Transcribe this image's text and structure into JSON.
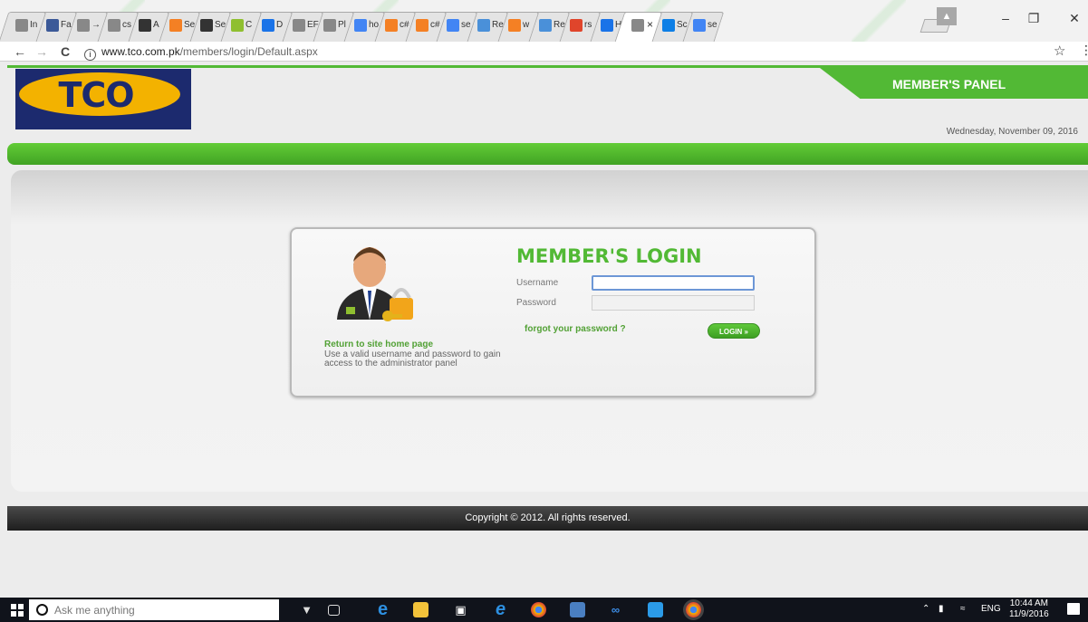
{
  "browser": {
    "tabs": [
      {
        "label": "In",
        "icon": "generic-icon",
        "color": "#888888"
      },
      {
        "label": "Fa",
        "icon": "facebook-icon",
        "color": "#3b5998"
      },
      {
        "label": "→",
        "icon": "page-icon",
        "color": "#888888"
      },
      {
        "label": "cs",
        "icon": "generic-icon",
        "color": "#888888"
      },
      {
        "label": "A",
        "icon": "codepen-icon",
        "color": "#333333"
      },
      {
        "label": "Se",
        "icon": "asterisk-icon",
        "color": "#f48024"
      },
      {
        "label": "Se",
        "icon": "codepen-icon",
        "color": "#333333"
      },
      {
        "label": "C",
        "icon": "app-icon",
        "color": "#8fbf30"
      },
      {
        "label": "D",
        "icon": "refresh-icon",
        "color": "#1a73e8"
      },
      {
        "label": "EF",
        "icon": "loading-icon",
        "color": "#888888"
      },
      {
        "label": "Pl",
        "icon": "loading-icon",
        "color": "#888888"
      },
      {
        "label": "ho",
        "icon": "google-icon",
        "color": "#4285f4"
      },
      {
        "label": "c#",
        "icon": "stackoverflow-icon",
        "color": "#f48024"
      },
      {
        "label": "c#",
        "icon": "stackoverflow-icon",
        "color": "#f48024"
      },
      {
        "label": "se",
        "icon": "google-icon",
        "color": "#4285f4"
      },
      {
        "label": "Re",
        "icon": "globe-icon",
        "color": "#4a90d9"
      },
      {
        "label": "w",
        "icon": "stackoverflow-icon",
        "color": "#f48024"
      },
      {
        "label": "Re",
        "icon": "globe-icon",
        "color": "#4a90d9"
      },
      {
        "label": "rs",
        "icon": "settings-icon",
        "color": "#e0452b"
      },
      {
        "label": "H",
        "icon": "refresh-icon",
        "color": "#1a73e8"
      },
      {
        "label": "×",
        "icon": "page-icon",
        "color": "#888888",
        "active": true
      },
      {
        "label": "Sc",
        "icon": "dropbox-icon",
        "color": "#0d7fe6"
      },
      {
        "label": "se",
        "icon": "google-icon",
        "color": "#4285f4"
      }
    ],
    "url_host": "www.tco.com.pk",
    "url_path": "/members/login/Default.aspx"
  },
  "header": {
    "logo_text": "TCO",
    "member_panel_label": "MEMBER'S PANEL",
    "date": "Wednesday, November 09, 2016"
  },
  "login": {
    "title": "MEMBER'S LOGIN",
    "username_label": "Username",
    "password_label": "Password",
    "username_value": "",
    "password_value": "",
    "forgot_label": "forgot your password ?",
    "login_button_label": "LOGIN »",
    "home_link": "Return to site home page",
    "help_text": "Use a valid username and password to gain access to the administrator panel"
  },
  "footer": {
    "copyright": "Copyright © 2012. All rights reserved."
  },
  "taskbar": {
    "search_placeholder": "Ask me anything",
    "language": "ENG",
    "time": "10:44 AM",
    "date": "11/9/2016"
  },
  "colors": {
    "brand_green": "#52b935",
    "logo_yellow": "#f3b200",
    "logo_navy": "#1c2a6e",
    "taskbar": "#10131b"
  }
}
